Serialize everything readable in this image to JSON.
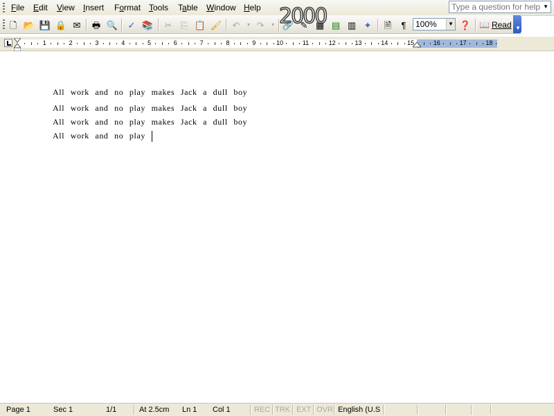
{
  "menubar": {
    "items": [
      {
        "label": "File",
        "accel": "F"
      },
      {
        "label": "Edit",
        "accel": "E"
      },
      {
        "label": "View",
        "accel": "V"
      },
      {
        "label": "Insert",
        "accel": "I"
      },
      {
        "label": "Format",
        "accel": "o"
      },
      {
        "label": "Tools",
        "accel": "T"
      },
      {
        "label": "Table",
        "accel": "a"
      },
      {
        "label": "Window",
        "accel": "W"
      },
      {
        "label": "Help",
        "accel": "H"
      }
    ],
    "help_placeholder": "Type a question for help"
  },
  "toolbar": {
    "zoom": "100%",
    "read_label": "Read",
    "stamp_text": "2000"
  },
  "ruler": {
    "numbers": [
      "1",
      "2",
      "3",
      "4",
      "5",
      "6",
      "7",
      "8",
      "9",
      "10",
      "11",
      "12",
      "13",
      "14",
      "15",
      "16",
      "17",
      "18"
    ]
  },
  "document": {
    "lines": [
      "All work and no play makes Jack a dull boy",
      "All work and no play makes Jack a dull boy",
      "All work and no play makes Jack a dull boy",
      "All work and no play"
    ]
  },
  "statusbar": {
    "page": "Page 1",
    "sec": "Sec 1",
    "pages": "1/1",
    "at": "At 2.5cm",
    "ln": "Ln 1",
    "col": "Col 1",
    "rec": "REC",
    "trk": "TRK",
    "ext": "EXT",
    "ovr": "OVR",
    "language": "English (U.S"
  }
}
